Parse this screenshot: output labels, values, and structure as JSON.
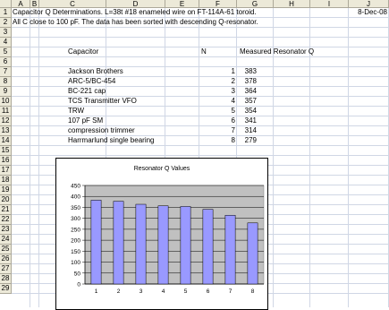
{
  "columns": [
    "A",
    "B",
    "C",
    "D",
    "E",
    "F",
    "G",
    "H",
    "I",
    "J"
  ],
  "rows": [
    "1",
    "2",
    "3",
    "4",
    "5",
    "6",
    "7",
    "8",
    "9",
    "10",
    "11",
    "12",
    "13",
    "14",
    "15",
    "16",
    "17",
    "18",
    "19",
    "20",
    "21",
    "22",
    "23",
    "24",
    "25",
    "26",
    "27",
    "28",
    "29"
  ],
  "sheet": {
    "title_line": "Capacitor Q Determinations.   L=38t #18 enameled wire on FT-114A-61 toroid.",
    "date": "8-Dec-08",
    "note_line": "All C  close to 100 pF.   The data has been sorted with descending Q-resonator.",
    "header_capacitor": "Capacitor",
    "header_n": "N",
    "header_q": "Measured Resonator Q",
    "rows": [
      {
        "capacitor": "Jackson Brothers",
        "n": "1",
        "q": "383"
      },
      {
        "capacitor": "ARC-5/BC-454",
        "n": "2",
        "q": "378"
      },
      {
        "capacitor": "BC-221 cap",
        "n": "3",
        "q": "364"
      },
      {
        "capacitor": "TCS Transmitter VFO",
        "n": "4",
        "q": "357"
      },
      {
        "capacitor": "TRW",
        "n": "5",
        "q": "354"
      },
      {
        "capacitor": "107 pF SM",
        "n": "6",
        "q": "341"
      },
      {
        "capacitor": "compression trimmer",
        "n": "7",
        "q": "314"
      },
      {
        "capacitor": "Harrmarlund single bearing",
        "n": "8",
        "q": "279"
      }
    ]
  },
  "chart_data": {
    "type": "bar",
    "title": "Resonator Q Values",
    "categories": [
      "1",
      "2",
      "3",
      "4",
      "5",
      "6",
      "7",
      "8"
    ],
    "values": [
      383,
      378,
      364,
      357,
      354,
      341,
      314,
      279
    ],
    "yticks": [
      "0",
      "50",
      "100",
      "150",
      "200",
      "250",
      "300",
      "350",
      "400",
      "450"
    ],
    "ylim": [
      0,
      450
    ],
    "grid": true,
    "plot_background": "#c0c0c0",
    "bar_color": "#9999ff"
  }
}
